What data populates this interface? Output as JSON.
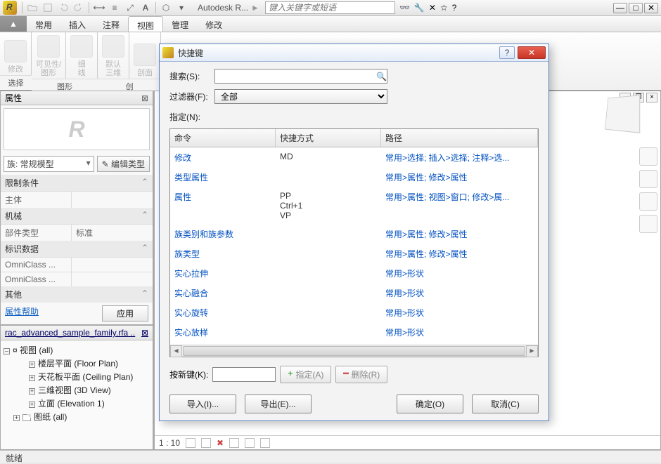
{
  "topbar": {
    "title": "Autodesk R...",
    "unknown": "►",
    "search_ph": "键入关键字或短语"
  },
  "ribbon": {
    "arrow": "▲",
    "tabs": [
      "常用",
      "插入",
      "注释",
      "视图",
      "管理",
      "修改"
    ],
    "active": 3,
    "panels": [
      {
        "label": "修改"
      },
      {
        "label": "可见性/\n图形"
      },
      {
        "label": "细\n线"
      },
      {
        "label": "默认\n三维"
      },
      {
        "label": "剖面"
      }
    ],
    "groups": [
      "选择",
      "图形",
      "创"
    ]
  },
  "props": {
    "title": "属性",
    "type_selector": "族: 常规模型",
    "edit_type": "编辑类型",
    "groups": [
      {
        "name": "限制条件",
        "rows": [
          {
            "k": "主体",
            "v": ""
          }
        ]
      },
      {
        "name": "机械",
        "rows": [
          {
            "k": "部件类型",
            "v": "标准"
          }
        ]
      },
      {
        "name": "标识数据",
        "rows": [
          {
            "k": "OmniClass ...",
            "v": ""
          },
          {
            "k": "OmniClass ...",
            "v": ""
          }
        ]
      },
      {
        "name": "其他",
        "rows": []
      }
    ],
    "help": "属性帮助",
    "apply": "应用"
  },
  "browser": {
    "title": "rac_advanced_sample_family.rfa ..",
    "root": "视图 (all)",
    "items": [
      "楼层平面 (Floor Plan)",
      "天花板平面 (Ceiling Plan)",
      "三维视图 (3D View)",
      "立面 (Elevation 1)"
    ],
    "sheets": "图纸 (all)"
  },
  "canvas": {
    "scale": "1 : 10"
  },
  "dialog": {
    "title": "快捷键",
    "search_label": "搜索(S):",
    "filter_label": "过滤器(F):",
    "filter_value": "全部",
    "assign_label": "指定(N):",
    "columns": [
      "命令",
      "快捷方式",
      "路径"
    ],
    "rows": [
      {
        "cmd": "修改",
        "key": "MD",
        "path": "常用>选择; 插入>选择; 注释>选..."
      },
      {
        "cmd": "类型属性",
        "key": "",
        "path": "常用>属性; 修改>属性"
      },
      {
        "cmd": "属性",
        "key": "PP\nCtrl+1\nVP",
        "path": "常用>属性; 视图>窗口; 修改>属..."
      },
      {
        "cmd": "族类别和族参数",
        "key": "",
        "path": "常用>属性; 修改>属性"
      },
      {
        "cmd": "族类型",
        "key": "",
        "path": "常用>属性; 修改>属性"
      },
      {
        "cmd": "实心拉伸",
        "key": "",
        "path": "常用>形状"
      },
      {
        "cmd": "实心融合",
        "key": "",
        "path": "常用>形状"
      },
      {
        "cmd": "实心旋转",
        "key": "",
        "path": "常用>形状"
      },
      {
        "cmd": "实心放样",
        "key": "",
        "path": "常用>形状"
      }
    ],
    "newkey_label": "按新键(K):",
    "assign_btn": "指定(A)",
    "remove_btn": "删除(R)",
    "import_btn": "导入(I)...",
    "export_btn": "导出(E)...",
    "ok_btn": "确定(O)",
    "cancel_btn": "取消(C)"
  },
  "status": "就绪"
}
